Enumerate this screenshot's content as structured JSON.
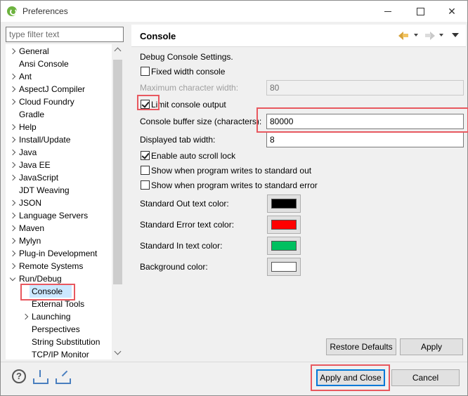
{
  "window": {
    "title": "Preferences",
    "minimize": "",
    "maximize": "",
    "close": "✕"
  },
  "filter": {
    "placeholder": "type filter text"
  },
  "tree": [
    {
      "label": "General",
      "expandable": true
    },
    {
      "label": "Ansi Console",
      "expandable": false
    },
    {
      "label": "Ant",
      "expandable": true
    },
    {
      "label": "AspectJ Compiler",
      "expandable": true
    },
    {
      "label": "Cloud Foundry",
      "expandable": true
    },
    {
      "label": "Gradle",
      "expandable": false
    },
    {
      "label": "Help",
      "expandable": true
    },
    {
      "label": "Install/Update",
      "expandable": true
    },
    {
      "label": "Java",
      "expandable": true
    },
    {
      "label": "Java EE",
      "expandable": true
    },
    {
      "label": "JavaScript",
      "expandable": true
    },
    {
      "label": "JDT Weaving",
      "expandable": false
    },
    {
      "label": "JSON",
      "expandable": true
    },
    {
      "label": "Language Servers",
      "expandable": true
    },
    {
      "label": "Maven",
      "expandable": true
    },
    {
      "label": "Mylyn",
      "expandable": true
    },
    {
      "label": "Plug-in Development",
      "expandable": true
    },
    {
      "label": "Remote Systems",
      "expandable": true
    },
    {
      "label": "Run/Debug",
      "expandable": true,
      "expanded": true
    },
    {
      "label": "Console",
      "expandable": false,
      "selected": true
    },
    {
      "label": "External Tools",
      "expandable": false
    },
    {
      "label": "Launching",
      "expandable": true
    },
    {
      "label": "Perspectives",
      "expandable": false
    },
    {
      "label": "String Substitution",
      "expandable": false
    },
    {
      "label": "TCP/IP Monitor",
      "expandable": false
    }
  ],
  "panel": {
    "title": "Console",
    "section_label": "Debug Console Settings.",
    "fixed_width_label": "Fixed width console",
    "fixed_width_checked": false,
    "max_char_width_label": "Maximum character width:",
    "max_char_width_value": "80",
    "limit_output_label": "Limit console output",
    "limit_output_checked": true,
    "buffer_size_label": "Console buffer size (characters):",
    "buffer_size_value": "80000",
    "tab_width_label": "Displayed tab width:",
    "tab_width_value": "8",
    "auto_scroll_label": "Enable auto scroll lock",
    "auto_scroll_checked": true,
    "show_stdout_label": "Show when program writes to standard out",
    "show_stdout_checked": false,
    "show_stderr_label": "Show when program writes to standard error",
    "show_stderr_checked": false,
    "colors": [
      {
        "label": "Standard Out text color:",
        "color": "#000000"
      },
      {
        "label": "Standard Error text color:",
        "color": "#ff0000"
      },
      {
        "label": "Standard In text color:",
        "color": "#00c060"
      },
      {
        "label": "Background color:",
        "color": "#ffffff"
      }
    ],
    "restore_defaults": "Restore Defaults",
    "apply": "Apply"
  },
  "footer": {
    "help": "?",
    "apply_and_close": "Apply and Close",
    "cancel": "Cancel"
  }
}
